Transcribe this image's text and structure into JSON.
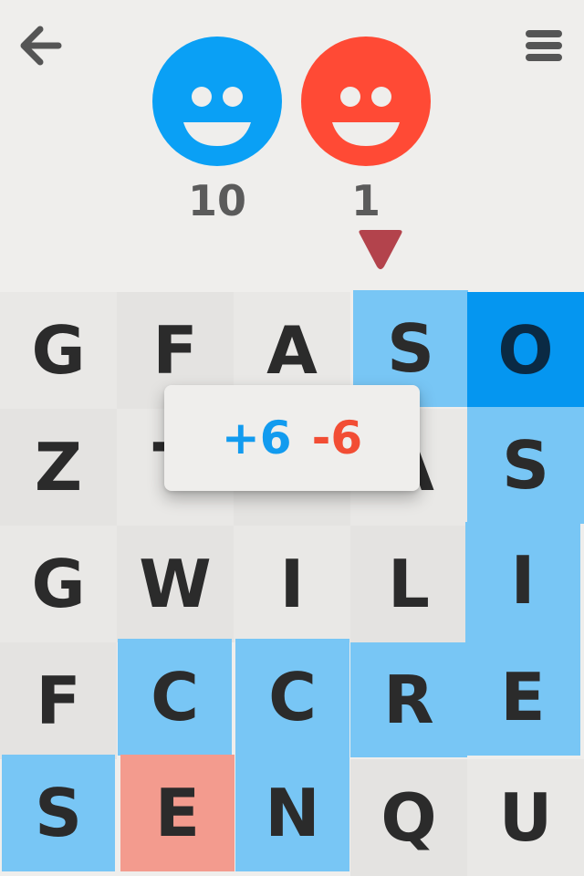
{
  "colors": {
    "blue_player": "#0aa0f5",
    "red_player": "#ff4a35",
    "blue_light": "#78c6f5",
    "blue_dark": "#0596f0",
    "red_light": "#f39b8e",
    "neutral": "#e9e8e6",
    "turn_indicator": "#b3434c"
  },
  "header": {
    "back_icon": "arrow-left-icon",
    "menu_icon": "hamburger-menu-icon",
    "players": [
      {
        "color": "blue",
        "score": "10"
      },
      {
        "color": "red",
        "score": "1"
      }
    ],
    "turn": "red"
  },
  "board": {
    "rows": [
      [
        {
          "letter": "G",
          "owner": "none"
        },
        {
          "letter": "F",
          "owner": "none"
        },
        {
          "letter": "A",
          "owner": "none"
        },
        {
          "letter": "S",
          "owner": "blue"
        },
        {
          "letter": "O",
          "owner": "blue-locked"
        }
      ],
      [
        {
          "letter": "Z",
          "owner": "none"
        },
        {
          "letter": "T",
          "owner": "none"
        },
        {
          "letter": "",
          "owner": "none"
        },
        {
          "letter": "A",
          "owner": "none"
        },
        {
          "letter": "S",
          "owner": "blue"
        }
      ],
      [
        {
          "letter": "G",
          "owner": "none"
        },
        {
          "letter": "W",
          "owner": "none"
        },
        {
          "letter": "I",
          "owner": "none"
        },
        {
          "letter": "L",
          "owner": "none"
        },
        {
          "letter": "I",
          "owner": "blue"
        }
      ],
      [
        {
          "letter": "F",
          "owner": "none"
        },
        {
          "letter": "C",
          "owner": "blue"
        },
        {
          "letter": "C",
          "owner": "blue"
        },
        {
          "letter": "R",
          "owner": "blue"
        },
        {
          "letter": "E",
          "owner": "blue"
        }
      ],
      [
        {
          "letter": "S",
          "owner": "blue"
        },
        {
          "letter": "E",
          "owner": "red"
        },
        {
          "letter": "N",
          "owner": "blue"
        },
        {
          "letter": "Q",
          "owner": "none"
        },
        {
          "letter": "U",
          "owner": "none"
        }
      ]
    ]
  },
  "popup": {
    "plus": "+6",
    "minus": "-6"
  }
}
